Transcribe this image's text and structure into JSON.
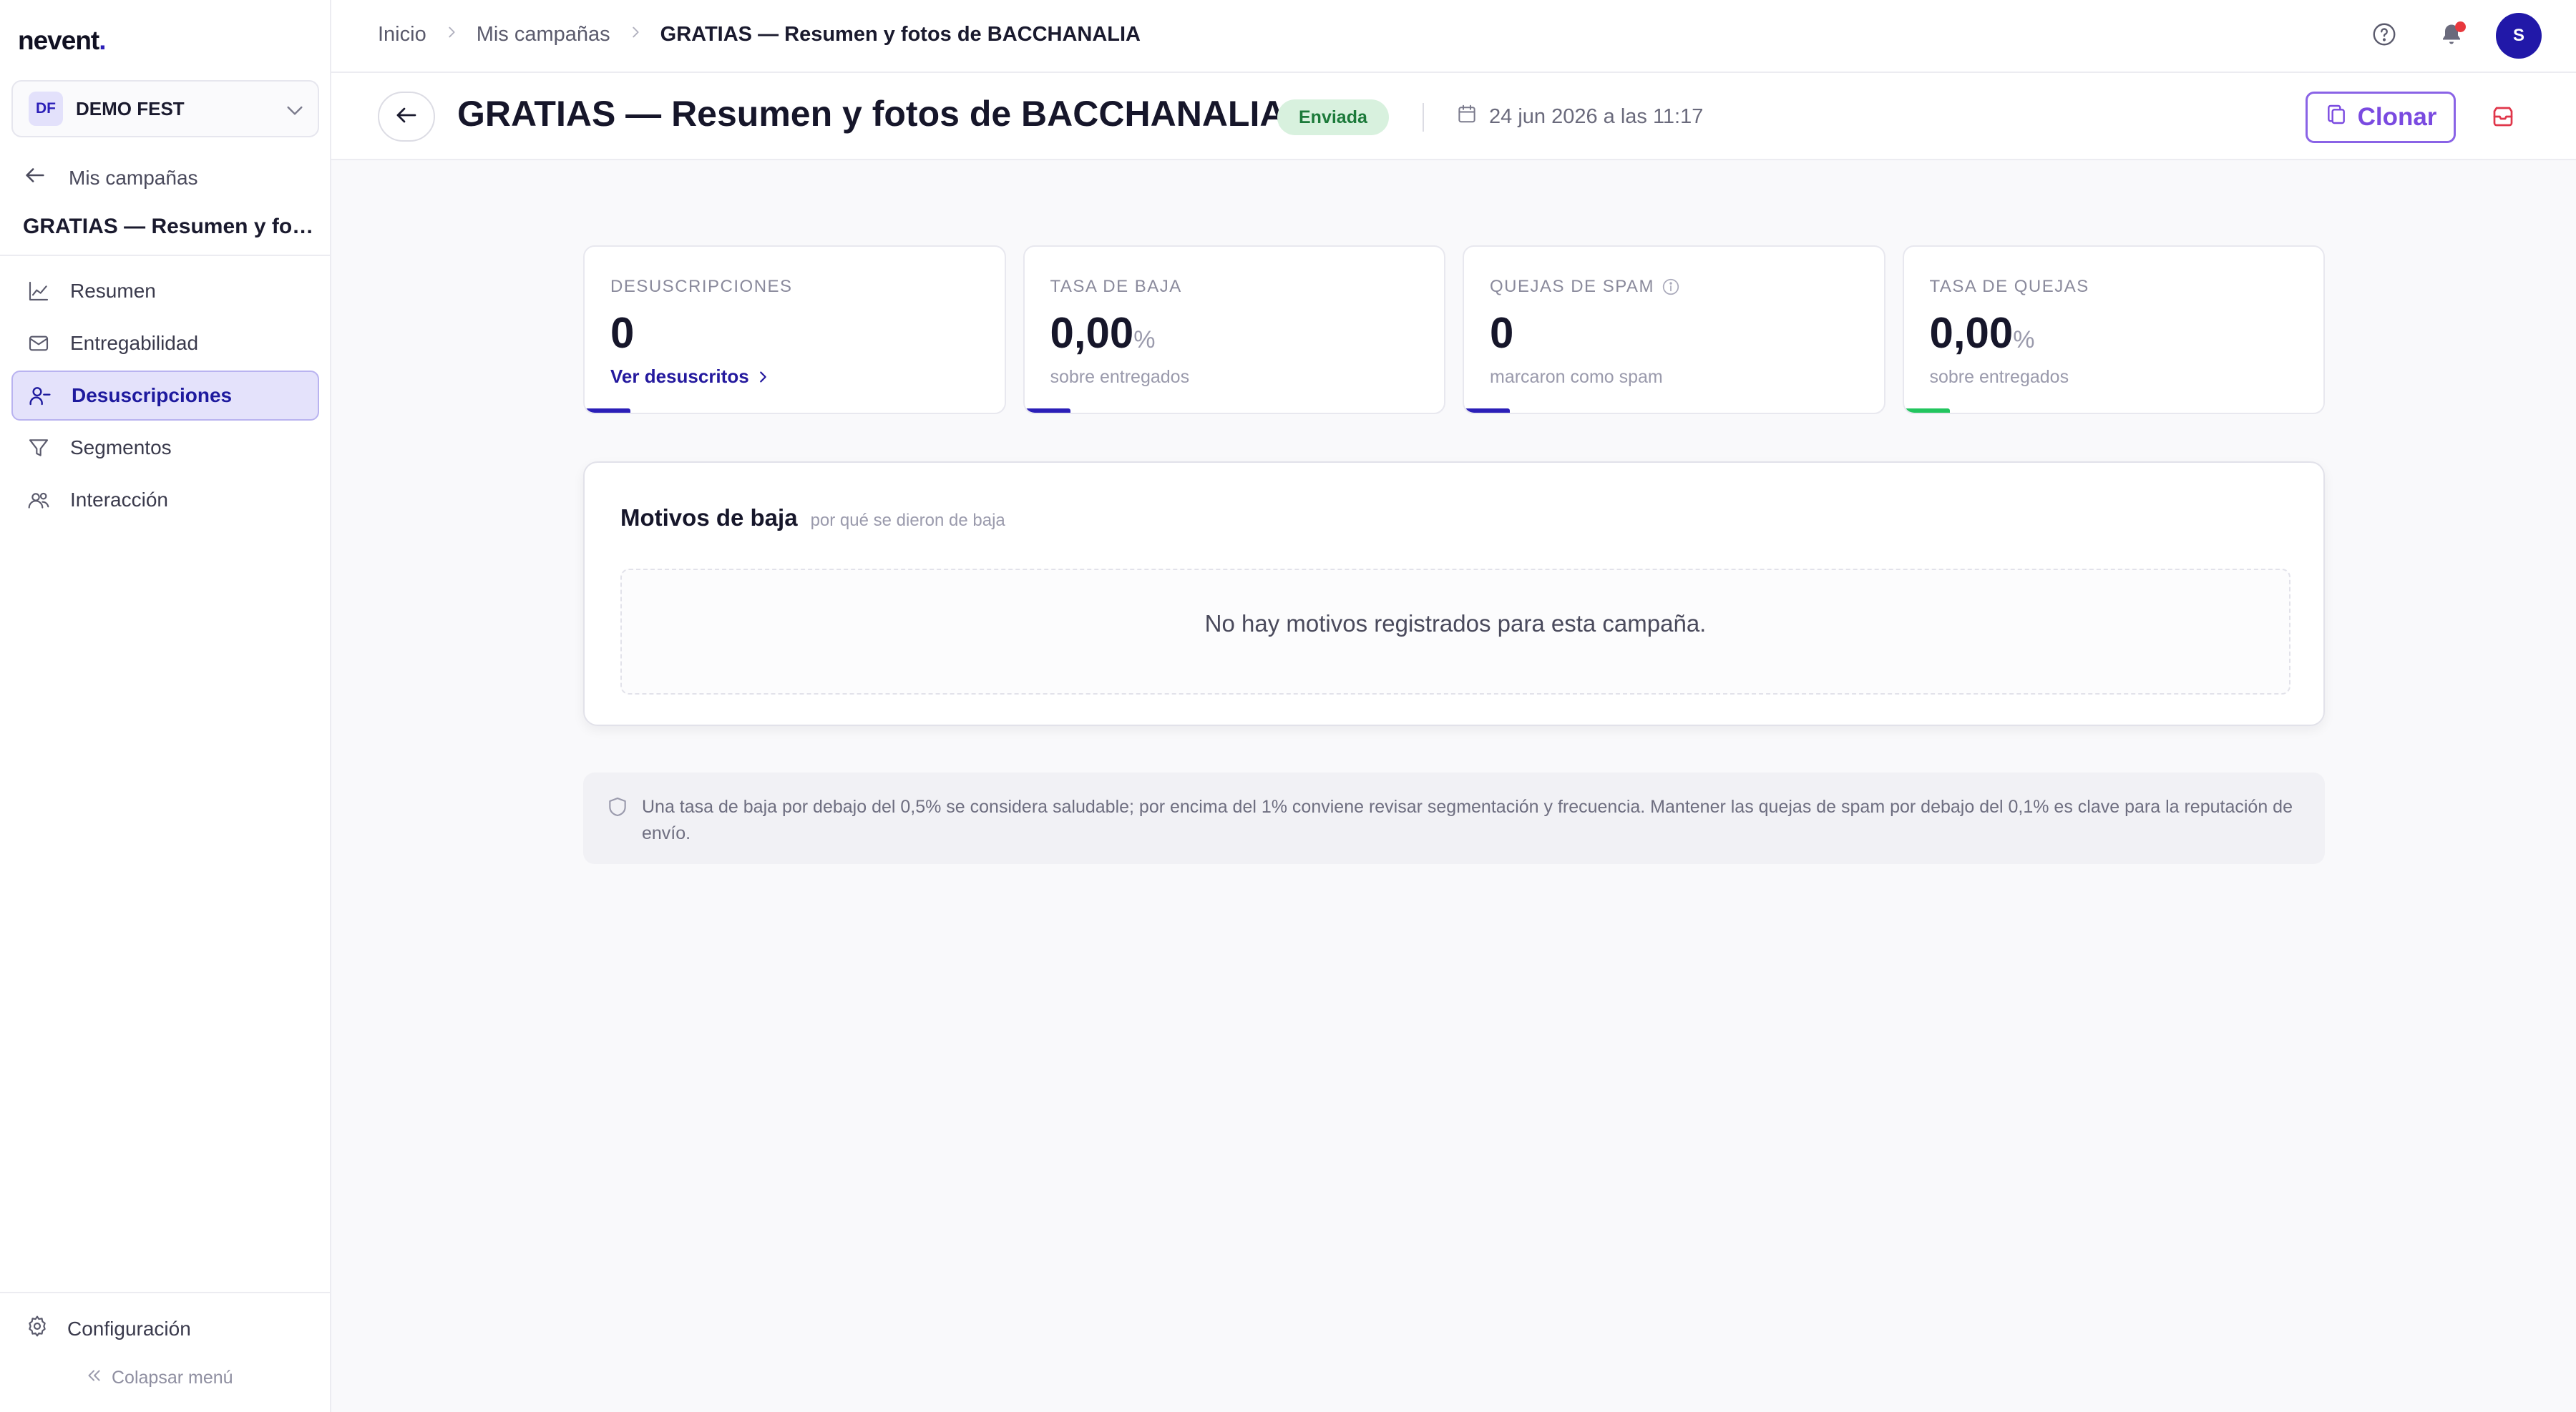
{
  "brand": {
    "logo_text": "nevent",
    "logo_dot": "."
  },
  "org": {
    "initials": "DF",
    "name": "DEMO FEST"
  },
  "sidebar": {
    "back_label": "Mis campañas",
    "campaign_title": "GRATIAS — Resumen y fotos de BACCHANALIA",
    "items": [
      {
        "label": "Resumen",
        "icon": "chart-line-icon",
        "active": false
      },
      {
        "label": "Entregabilidad",
        "icon": "mail-icon",
        "active": false
      },
      {
        "label": "Desuscripciones",
        "icon": "user-minus-icon",
        "active": true
      },
      {
        "label": "Segmentos",
        "icon": "filter-icon",
        "active": false
      },
      {
        "label": "Interacción",
        "icon": "users-icon",
        "active": false
      }
    ],
    "settings_label": "Configuración",
    "collapse_label": "Colapsar menú"
  },
  "breadcrumb": {
    "items": [
      "Inicio",
      "Mis campañas",
      "GRATIAS — Resumen y fotos de BACCHANALIA"
    ]
  },
  "header": {
    "title": "GRATIAS — Resumen y fotos de BACCHANALIA",
    "status": "Enviada",
    "date": "24 jun 2026 a las 11:17",
    "clone_label": "Clonar"
  },
  "user": {
    "avatar_initial": "S"
  },
  "stats": [
    {
      "label": "DESUSCRIPCIONES",
      "value": "0",
      "unit": "",
      "link": "Ver desuscritos",
      "sub": "",
      "accent": "#2b1fb8"
    },
    {
      "label": "TASA DE BAJA",
      "value": "0,00",
      "unit": "%",
      "link": "",
      "sub": "sobre entregados",
      "accent": "#2b1fb8"
    },
    {
      "label": "QUEJAS DE SPAM",
      "value": "0",
      "unit": "",
      "link": "",
      "sub": "marcaron como spam",
      "accent": "#2b1fb8"
    },
    {
      "label": "TASA DE QUEJAS",
      "value": "0,00",
      "unit": "%",
      "link": "",
      "sub": "sobre entregados",
      "accent": "#22c55e"
    }
  ],
  "reasons": {
    "title": "Motivos de baja",
    "hint": "por qué se dieron de baja",
    "empty": "No hay motivos registrados para esta campaña."
  },
  "note": {
    "text": "Una tasa de baja por debajo del 0,5% se considera saludable; por encima del 1% conviene revisar segmentación y frecuencia. Mantener las quejas de spam por debajo del 0,1% es clave para la reputación de envío."
  },
  "colors": {
    "accent": "#2b1fb8",
    "clone": "#7a4ae0",
    "success": "#22c55e",
    "notification": "#e8383d"
  }
}
